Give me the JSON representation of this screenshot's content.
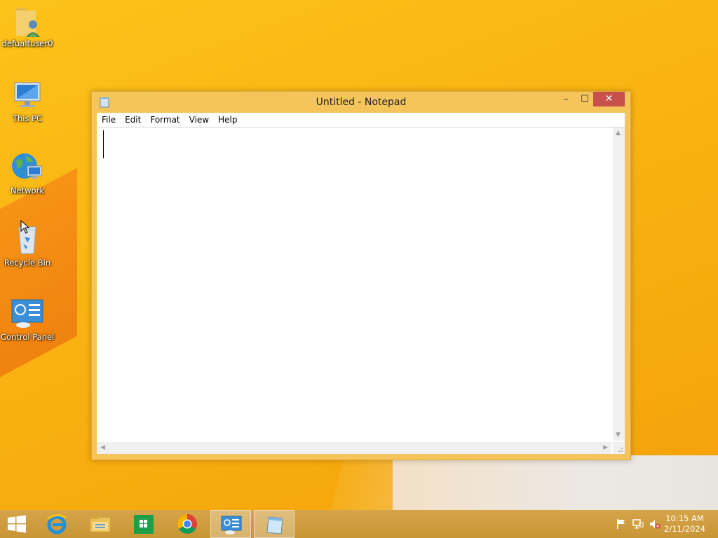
{
  "desktop": {
    "icons": [
      {
        "label": "defualtuser0",
        "icon": "user-folder-icon"
      },
      {
        "label": "This PC",
        "icon": "computer-icon"
      },
      {
        "label": "Network",
        "icon": "network-icon"
      },
      {
        "label": "Recycle Bin",
        "icon": "recycle-bin-icon"
      },
      {
        "label": "Control Panel",
        "icon": "control-panel-icon"
      }
    ]
  },
  "notepad": {
    "title": "Untitled - Notepad",
    "menu": [
      "File",
      "Edit",
      "Format",
      "View",
      "Help"
    ],
    "content": "",
    "controls": {
      "minimize": "–",
      "maximize": "☐",
      "close": "✕"
    }
  },
  "taskbar": {
    "buttons": [
      {
        "name": "start",
        "icon": "windows-logo-icon"
      },
      {
        "name": "internet-explorer",
        "icon": "internet-explorer-icon"
      },
      {
        "name": "file-explorer",
        "icon": "file-explorer-icon"
      },
      {
        "name": "store",
        "icon": "store-icon"
      },
      {
        "name": "chrome",
        "icon": "chrome-icon"
      },
      {
        "name": "control-panel",
        "icon": "control-panel-icon"
      },
      {
        "name": "notepad",
        "icon": "notepad-icon"
      }
    ],
    "tray": {
      "icons": [
        "flag-icon",
        "network-icon",
        "volume-muted-icon"
      ],
      "time": "10:15 AM",
      "date": "2/11/2024"
    }
  },
  "colors": {
    "desktop_bg": "#f9b312",
    "taskbar_bg": "#cf9d3f",
    "window_frame": "#f5c55c",
    "close_button": "#c7504d"
  }
}
